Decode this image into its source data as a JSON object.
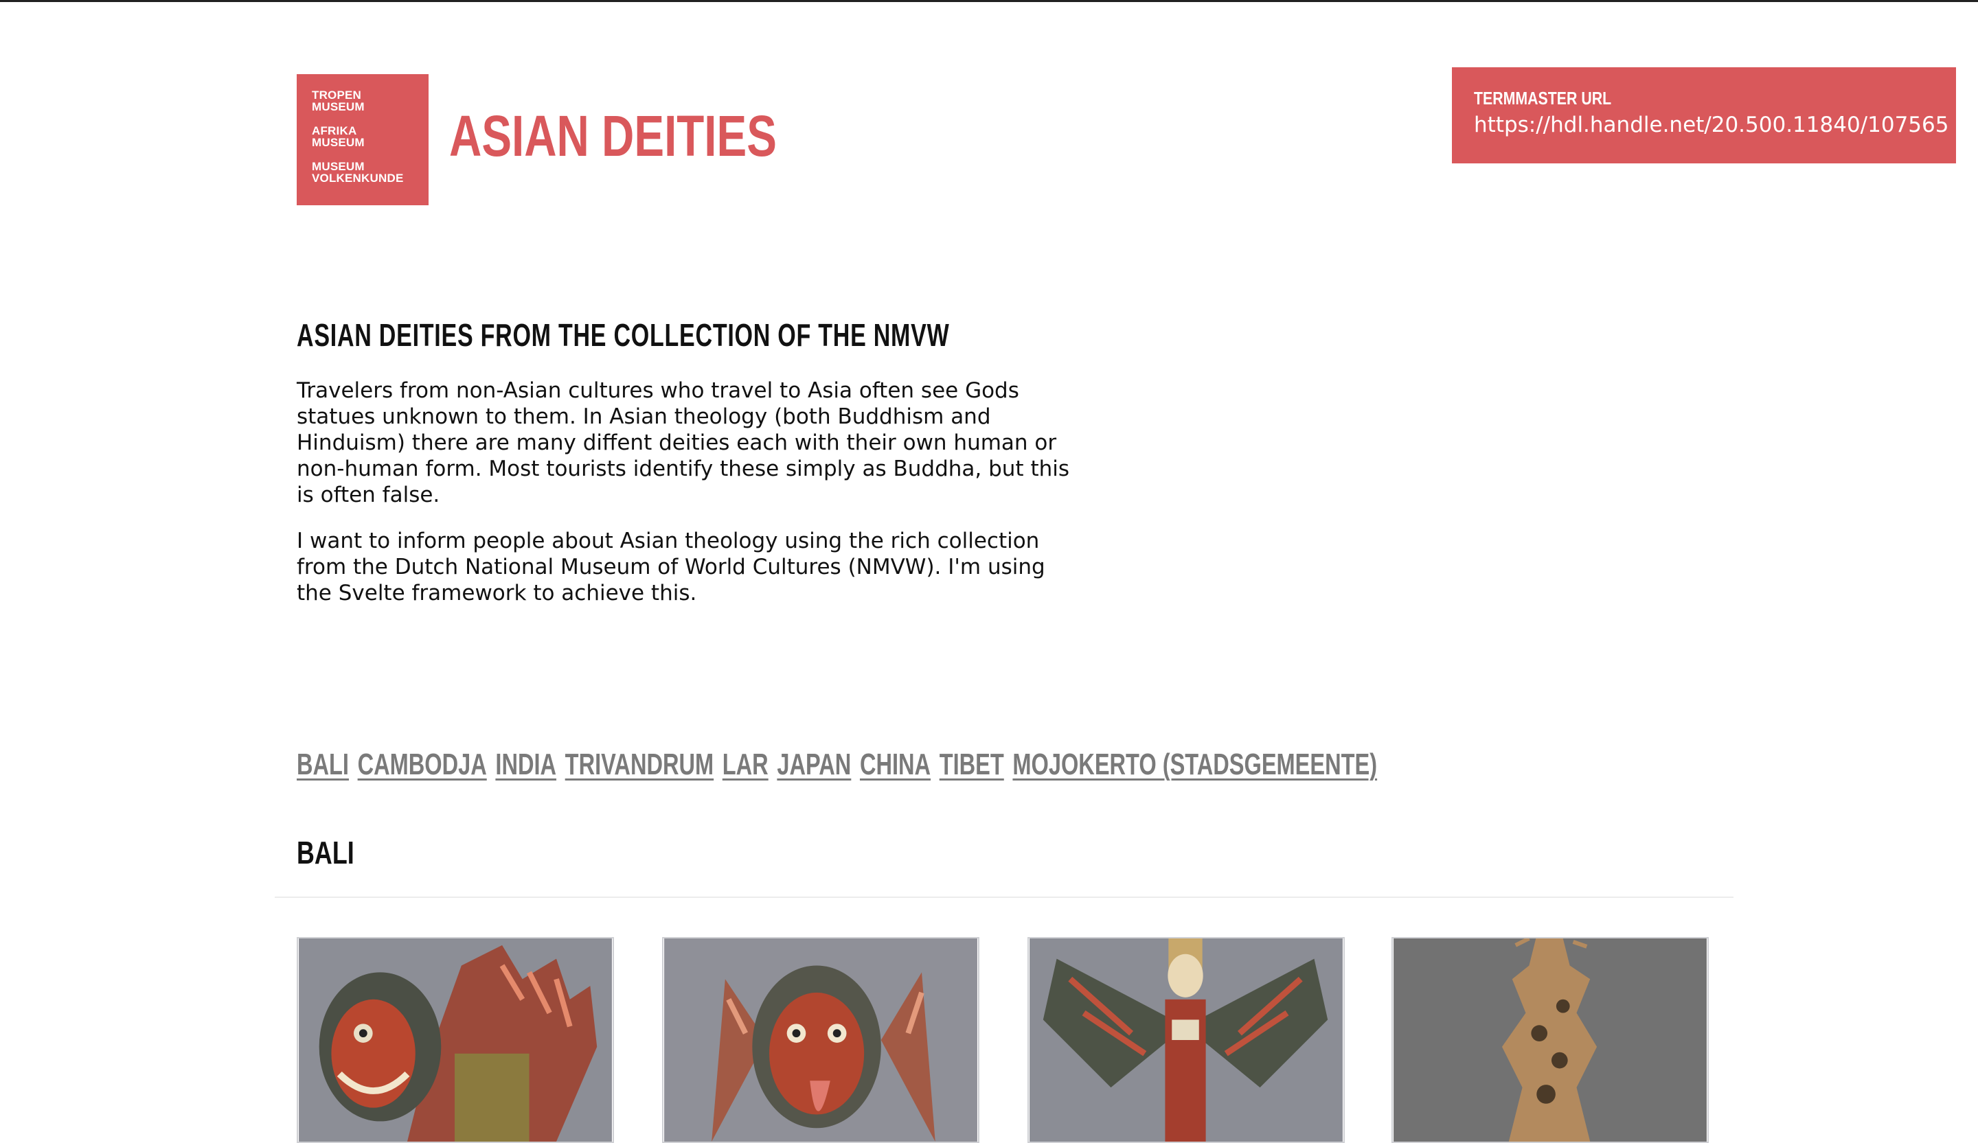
{
  "logo": {
    "lines": [
      "TROPEN",
      "MUSEUM",
      "AFRIKA",
      "MUSEUM",
      "MUSEUM",
      "VOLKENKUNDE"
    ]
  },
  "header": {
    "title": "ASIAN DEITIES"
  },
  "termmaster": {
    "label": "TERMMASTER URL",
    "url": "https://hdl.handle.net/20.500.11840/107565"
  },
  "intro": {
    "heading": "ASIAN DEITIES FROM THE COLLECTION OF THE NMVW",
    "paragraphs": [
      "Travelers from non-Asian cultures who travel to Asia often see Gods statues unknown to them. In Asian theology (both Buddhism and Hinduism) there are many diffent deities each with their own human or non-human form. Most tourists identify these simply as Buddha, but this is often false.",
      "I want to inform people about Asian theology using the rich collection from the Dutch National Museum of World Cultures (NMVW). I'm using the Svelte framework to achieve this."
    ]
  },
  "tabs": [
    "BALI",
    "CAMBODJA",
    "INDIA",
    "TRIVANDRUM",
    "LAR",
    "JAPAN",
    "CHINA",
    "TIBET",
    "MOJOKERTO (STADSGEMEENTE)"
  ],
  "section": {
    "title": "BALI"
  },
  "colors": {
    "brand": "#d9585b",
    "tab": "#7a7a7a",
    "text": "#111111"
  }
}
